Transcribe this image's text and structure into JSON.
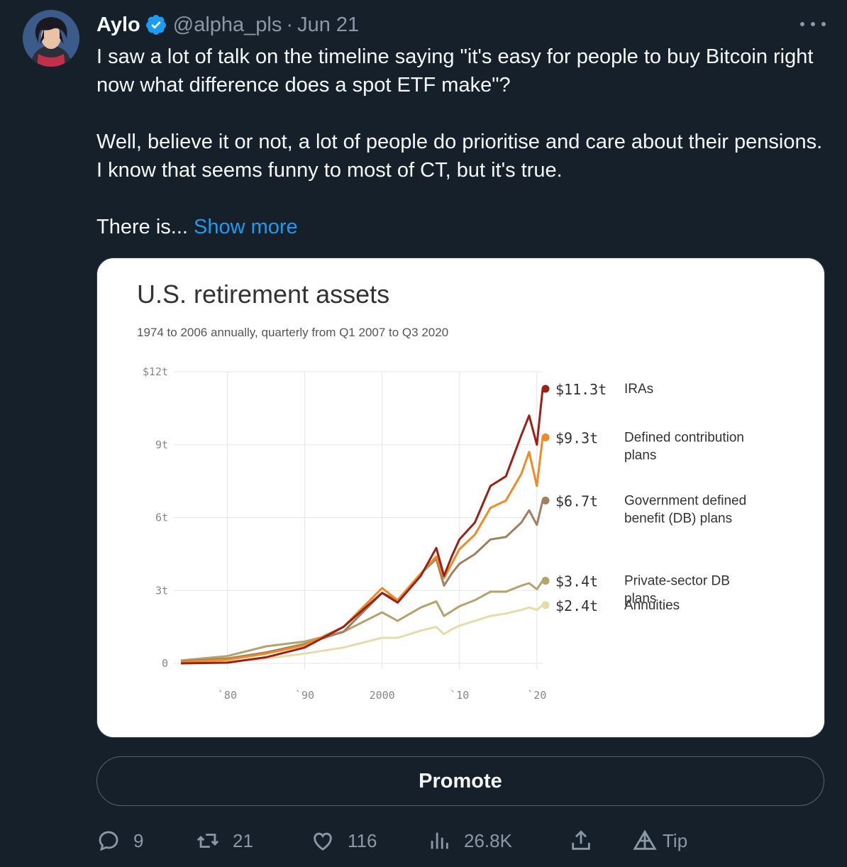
{
  "tweet": {
    "author_name": "Aylo",
    "handle": "@alpha_pls",
    "separator": "·",
    "date": "Jun 21",
    "paragraphs": [
      "I saw a lot of talk on the timeline saying \"it's easy for people to buy Bitcoin right now what difference does a spot ETF make\"?",
      "Well, believe it or not, a lot of people do prioritise and care about their pensions. I know that seems funny to most of CT, but it's true."
    ],
    "truncated_lead": "There is...",
    "show_more_label": "Show more"
  },
  "promote_label": "Promote",
  "actions": {
    "replies": "9",
    "reposts": "21",
    "likes": "116",
    "views": "26.8K",
    "tip_label": "Tip"
  },
  "colors": {
    "background": "#15202b",
    "accent": "#1d9bf0",
    "muted": "#8b98a5",
    "verified": "#1d9bf0"
  },
  "chart_data": {
    "type": "line",
    "title": "U.S. retirement assets",
    "subtitle": "1974 to 2006 annually, quarterly from Q1 2007 to Q3 2020",
    "y_ticks": [
      "$12t",
      "9t",
      "6t",
      "3t",
      "0"
    ],
    "y_tick_values": [
      12,
      9,
      6,
      3,
      0
    ],
    "x_ticks": [
      "`80",
      "`90",
      "2000",
      "`10",
      "`20"
    ],
    "x_tick_values": [
      1980,
      1990,
      2000,
      2010,
      2020
    ],
    "xlim": [
      1974,
      2020.75
    ],
    "ylim": [
      0,
      12
    ],
    "grid": true,
    "series": [
      {
        "name": "Annuities",
        "end_label": "$2.4t",
        "color": "#e6dcaa",
        "points": [
          [
            1974,
            0.02
          ],
          [
            1980,
            0.06
          ],
          [
            1985,
            0.2
          ],
          [
            1990,
            0.4
          ],
          [
            1995,
            0.65
          ],
          [
            2000,
            1.05
          ],
          [
            2002,
            1.05
          ],
          [
            2005,
            1.35
          ],
          [
            2007,
            1.5
          ],
          [
            2008,
            1.2
          ],
          [
            2009,
            1.4
          ],
          [
            2010,
            1.55
          ],
          [
            2012,
            1.75
          ],
          [
            2014,
            1.95
          ],
          [
            2016,
            2.05
          ],
          [
            2018,
            2.2
          ],
          [
            2019,
            2.3
          ],
          [
            2020,
            2.2
          ],
          [
            2020.75,
            2.4
          ]
        ]
      },
      {
        "name": "Private-sector DB plans",
        "end_label": "$3.4t",
        "color": "#b3a36c",
        "points": [
          [
            1974,
            0.12
          ],
          [
            1980,
            0.3
          ],
          [
            1985,
            0.7
          ],
          [
            1990,
            0.9
          ],
          [
            1995,
            1.3
          ],
          [
            2000,
            2.1
          ],
          [
            2002,
            1.75
          ],
          [
            2005,
            2.3
          ],
          [
            2007,
            2.55
          ],
          [
            2008,
            1.95
          ],
          [
            2009,
            2.15
          ],
          [
            2010,
            2.35
          ],
          [
            2012,
            2.6
          ],
          [
            2014,
            2.95
          ],
          [
            2016,
            2.95
          ],
          [
            2018,
            3.2
          ],
          [
            2019,
            3.3
          ],
          [
            2020,
            3.05
          ],
          [
            2020.75,
            3.4
          ]
        ]
      },
      {
        "name": "Government defined benefit (DB) plans",
        "end_label": "$6.7t",
        "color": "#a08060",
        "points": [
          [
            1974,
            0.08
          ],
          [
            1980,
            0.2
          ],
          [
            1985,
            0.45
          ],
          [
            1990,
            0.8
          ],
          [
            1995,
            1.3
          ],
          [
            2000,
            2.9
          ],
          [
            2002,
            2.6
          ],
          [
            2005,
            3.7
          ],
          [
            2007,
            4.3
          ],
          [
            2008,
            3.2
          ],
          [
            2009,
            3.7
          ],
          [
            2010,
            4.1
          ],
          [
            2012,
            4.5
          ],
          [
            2014,
            5.1
          ],
          [
            2016,
            5.2
          ],
          [
            2018,
            5.8
          ],
          [
            2019,
            6.3
          ],
          [
            2020,
            5.7
          ],
          [
            2020.75,
            6.7
          ]
        ]
      },
      {
        "name": "Defined contribution plans",
        "end_label": "$9.3t",
        "color": "#f08a24",
        "points": [
          [
            1974,
            0.05
          ],
          [
            1980,
            0.15
          ],
          [
            1985,
            0.4
          ],
          [
            1990,
            0.75
          ],
          [
            1995,
            1.5
          ],
          [
            2000,
            3.1
          ],
          [
            2002,
            2.6
          ],
          [
            2005,
            3.7
          ],
          [
            2007,
            4.4
          ],
          [
            2008,
            3.5
          ],
          [
            2009,
            4.1
          ],
          [
            2010,
            4.7
          ],
          [
            2012,
            5.3
          ],
          [
            2014,
            6.4
          ],
          [
            2016,
            6.7
          ],
          [
            2018,
            7.8
          ],
          [
            2019,
            8.7
          ],
          [
            2020,
            7.3
          ],
          [
            2020.75,
            9.3
          ]
        ]
      },
      {
        "name": "IRAs",
        "end_label": "$11.3t",
        "color": "#9b2015",
        "points": [
          [
            1974,
            0.0
          ],
          [
            1980,
            0.03
          ],
          [
            1985,
            0.25
          ],
          [
            1990,
            0.65
          ],
          [
            1995,
            1.5
          ],
          [
            2000,
            2.9
          ],
          [
            2002,
            2.5
          ],
          [
            2005,
            3.6
          ],
          [
            2007,
            4.75
          ],
          [
            2008,
            3.6
          ],
          [
            2009,
            4.4
          ],
          [
            2010,
            5.1
          ],
          [
            2012,
            5.8
          ],
          [
            2014,
            7.3
          ],
          [
            2016,
            7.7
          ],
          [
            2018,
            9.4
          ],
          [
            2019,
            10.2
          ],
          [
            2020,
            9.0
          ],
          [
            2020.75,
            11.3
          ]
        ]
      }
    ]
  }
}
